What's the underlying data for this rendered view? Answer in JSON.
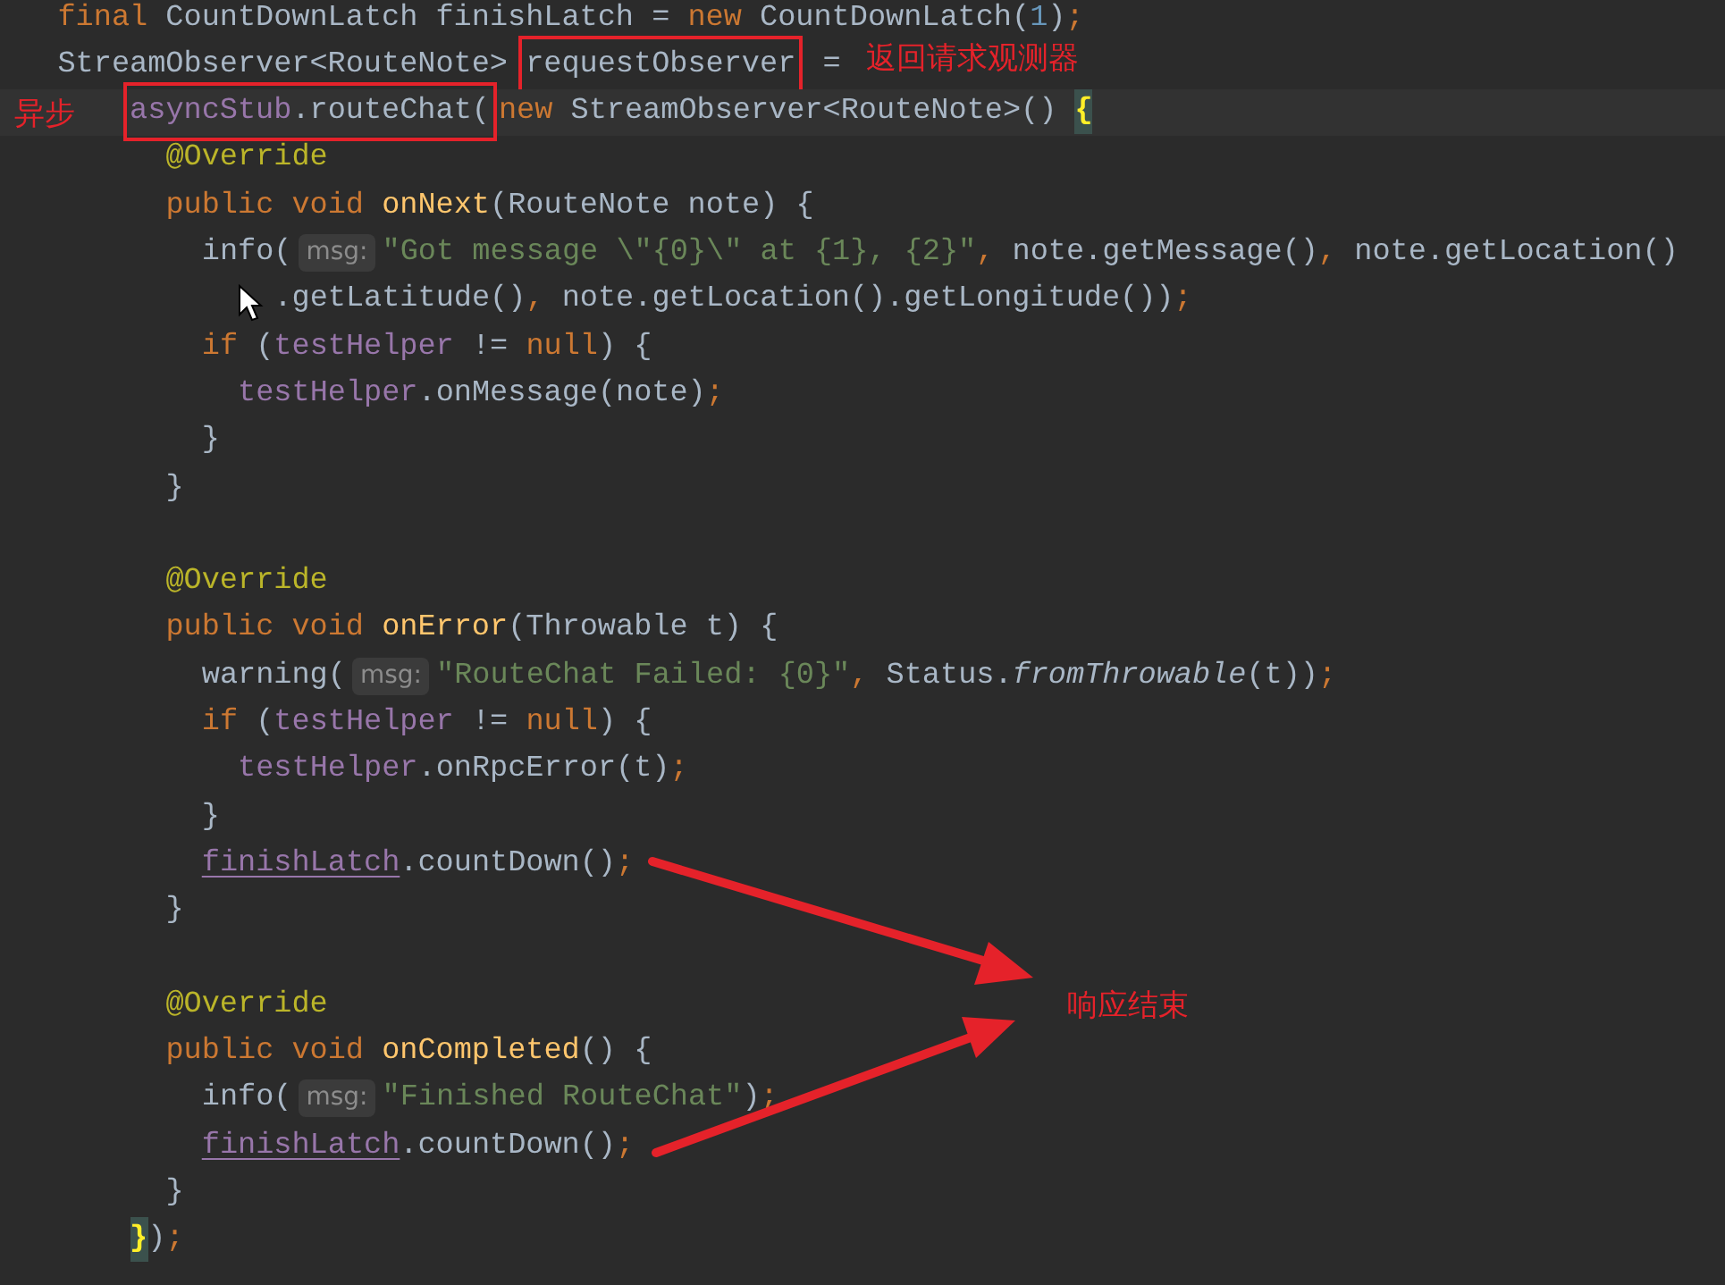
{
  "editor": {
    "lines": [
      {
        "kind": "code",
        "tokens": [
          {
            "kind": "kw",
            "text": "final "
          },
          {
            "kind": "plain",
            "text": "CountDownLatch finishLatch = "
          },
          {
            "kind": "kw",
            "text": "new "
          },
          {
            "kind": "plain",
            "text": "CountDownLatch("
          },
          {
            "kind": "num",
            "text": "1"
          },
          {
            "kind": "plain",
            "text": ")"
          },
          {
            "kind": "punct",
            "text": ";"
          }
        ]
      },
      {
        "kind": "code",
        "right_note": "返回请求观测器",
        "tokens": [
          {
            "kind": "plain",
            "text": "StreamObserver<RouteNote> "
          },
          {
            "kind": "plain",
            "text": "requestObserver",
            "boxed": true
          },
          {
            "kind": "plain",
            "text": " ="
          }
        ],
        "children": [
          {
            "kind": "code",
            "continuation": true,
            "current": true,
            "left_note": "异步",
            "tokens": [
              {
                "kind": "field",
                "text": "asyncStub",
                "boxed": true
              },
              {
                "kind": "plain",
                "text": ".routeChat(",
                "boxed": true
              },
              {
                "kind": "kw",
                "text": "new "
              },
              {
                "kind": "plain",
                "text": "StreamObserver<RouteNote>() "
              },
              {
                "kind": "match",
                "text": "{"
              }
            ],
            "children": [
              {
                "kind": "code",
                "tokens": [
                  {
                    "kind": "ann",
                    "text": "@Override"
                  }
                ]
              },
              {
                "kind": "code",
                "tokens": [
                  {
                    "kind": "kw",
                    "text": "public void "
                  },
                  {
                    "kind": "decl",
                    "text": "onNext"
                  },
                  {
                    "kind": "plain",
                    "text": "(RouteNote note) {"
                  }
                ],
                "children": [
                  {
                    "kind": "code",
                    "tokens": [
                      {
                        "kind": "plain",
                        "text": "info("
                      },
                      {
                        "kind": "hint",
                        "text": "msg:"
                      },
                      {
                        "kind": "str",
                        "text": "\"Got message \\\"{0}\\\" at {1}, {2}\""
                      },
                      {
                        "kind": "punct",
                        "text": ", "
                      },
                      {
                        "kind": "plain",
                        "text": "note.getMessage()"
                      },
                      {
                        "kind": "punct",
                        "text": ", "
                      },
                      {
                        "kind": "plain",
                        "text": "note.getLocation()"
                      }
                    ],
                    "children": [
                      {
                        "kind": "code",
                        "continuation": true,
                        "tokens": [
                          {
                            "kind": "plain",
                            "text": ".getLatitude()"
                          },
                          {
                            "kind": "punct",
                            "text": ", "
                          },
                          {
                            "kind": "plain",
                            "text": "note.getLocation().getLongitude())"
                          },
                          {
                            "kind": "punct",
                            "text": ";"
                          }
                        ]
                      }
                    ]
                  },
                  {
                    "kind": "code",
                    "tokens": [
                      {
                        "kind": "kw",
                        "text": "if "
                      },
                      {
                        "kind": "plain",
                        "text": "("
                      },
                      {
                        "kind": "field",
                        "text": "testHelper"
                      },
                      {
                        "kind": "plain",
                        "text": " != "
                      },
                      {
                        "kind": "kw",
                        "text": "null"
                      },
                      {
                        "kind": "plain",
                        "text": ") {"
                      }
                    ],
                    "children": [
                      {
                        "kind": "code",
                        "tokens": [
                          {
                            "kind": "field",
                            "text": "testHelper"
                          },
                          {
                            "kind": "plain",
                            "text": ".onMessage(note)"
                          },
                          {
                            "kind": "punct",
                            "text": ";"
                          }
                        ]
                      }
                    ]
                  },
                  {
                    "kind": "code",
                    "tokens": [
                      {
                        "kind": "plain",
                        "text": "}"
                      }
                    ]
                  }
                ]
              },
              {
                "kind": "code",
                "tokens": [
                  {
                    "kind": "plain",
                    "text": "}"
                  }
                ]
              },
              {
                "kind": "blank"
              },
              {
                "kind": "code",
                "tokens": [
                  {
                    "kind": "ann",
                    "text": "@Override"
                  }
                ]
              },
              {
                "kind": "code",
                "tokens": [
                  {
                    "kind": "kw",
                    "text": "public void "
                  },
                  {
                    "kind": "decl",
                    "text": "onError"
                  },
                  {
                    "kind": "plain",
                    "text": "(Throwable t) {"
                  }
                ],
                "children": [
                  {
                    "kind": "code",
                    "tokens": [
                      {
                        "kind": "plain",
                        "text": "warning("
                      },
                      {
                        "kind": "hint",
                        "text": "msg:"
                      },
                      {
                        "kind": "str",
                        "text": "\"RouteChat Failed: {0}\""
                      },
                      {
                        "kind": "punct",
                        "text": ", "
                      },
                      {
                        "kind": "plain",
                        "text": "Status."
                      },
                      {
                        "kind": "static",
                        "text": "fromThrowable"
                      },
                      {
                        "kind": "plain",
                        "text": "(t))"
                      },
                      {
                        "kind": "punct",
                        "text": ";"
                      }
                    ]
                  },
                  {
                    "kind": "code",
                    "tokens": [
                      {
                        "kind": "kw",
                        "text": "if "
                      },
                      {
                        "kind": "plain",
                        "text": "("
                      },
                      {
                        "kind": "field",
                        "text": "testHelper"
                      },
                      {
                        "kind": "plain",
                        "text": " != "
                      },
                      {
                        "kind": "kw",
                        "text": "null"
                      },
                      {
                        "kind": "plain",
                        "text": ") {"
                      }
                    ],
                    "children": [
                      {
                        "kind": "code",
                        "tokens": [
                          {
                            "kind": "field",
                            "text": "testHelper"
                          },
                          {
                            "kind": "plain",
                            "text": ".onRpcError(t)"
                          },
                          {
                            "kind": "punct",
                            "text": ";"
                          }
                        ]
                      }
                    ]
                  },
                  {
                    "kind": "code",
                    "tokens": [
                      {
                        "kind": "plain",
                        "text": "}"
                      }
                    ]
                  },
                  {
                    "kind": "code",
                    "tokens": [
                      {
                        "kind": "uline",
                        "text": "finishLatch"
                      },
                      {
                        "kind": "plain",
                        "text": ".countDown()"
                      },
                      {
                        "kind": "punct",
                        "text": ";"
                      }
                    ]
                  }
                ]
              },
              {
                "kind": "code",
                "tokens": [
                  {
                    "kind": "plain",
                    "text": "}"
                  }
                ]
              },
              {
                "kind": "blank"
              },
              {
                "kind": "code",
                "tokens": [
                  {
                    "kind": "ann",
                    "text": "@Override"
                  }
                ]
              },
              {
                "kind": "code",
                "tokens": [
                  {
                    "kind": "kw",
                    "text": "public void "
                  },
                  {
                    "kind": "decl",
                    "text": "onCompleted"
                  },
                  {
                    "kind": "plain",
                    "text": "() {"
                  }
                ],
                "children": [
                  {
                    "kind": "code",
                    "tokens": [
                      {
                        "kind": "plain",
                        "text": "info("
                      },
                      {
                        "kind": "hint",
                        "text": "msg:"
                      },
                      {
                        "kind": "str",
                        "text": "\"Finished RouteChat\""
                      },
                      {
                        "kind": "plain",
                        "text": ")"
                      },
                      {
                        "kind": "punct",
                        "text": ";"
                      }
                    ]
                  },
                  {
                    "kind": "code",
                    "tokens": [
                      {
                        "kind": "uline",
                        "text": "finishLatch"
                      },
                      {
                        "kind": "plain",
                        "text": ".countDown()"
                      },
                      {
                        "kind": "punct",
                        "text": ";"
                      }
                    ]
                  }
                ]
              },
              {
                "kind": "code",
                "tokens": [
                  {
                    "kind": "plain",
                    "text": "}"
                  }
                ]
              }
            ]
          },
          {
            "kind": "code",
            "continuation": true,
            "tokens": [
              {
                "kind": "match",
                "text": "}"
              },
              {
                "kind": "plain",
                "text": ")"
              },
              {
                "kind": "punct",
                "text": ";"
              }
            ]
          }
        ]
      }
    ]
  },
  "callout": {
    "text": "响应结束"
  }
}
